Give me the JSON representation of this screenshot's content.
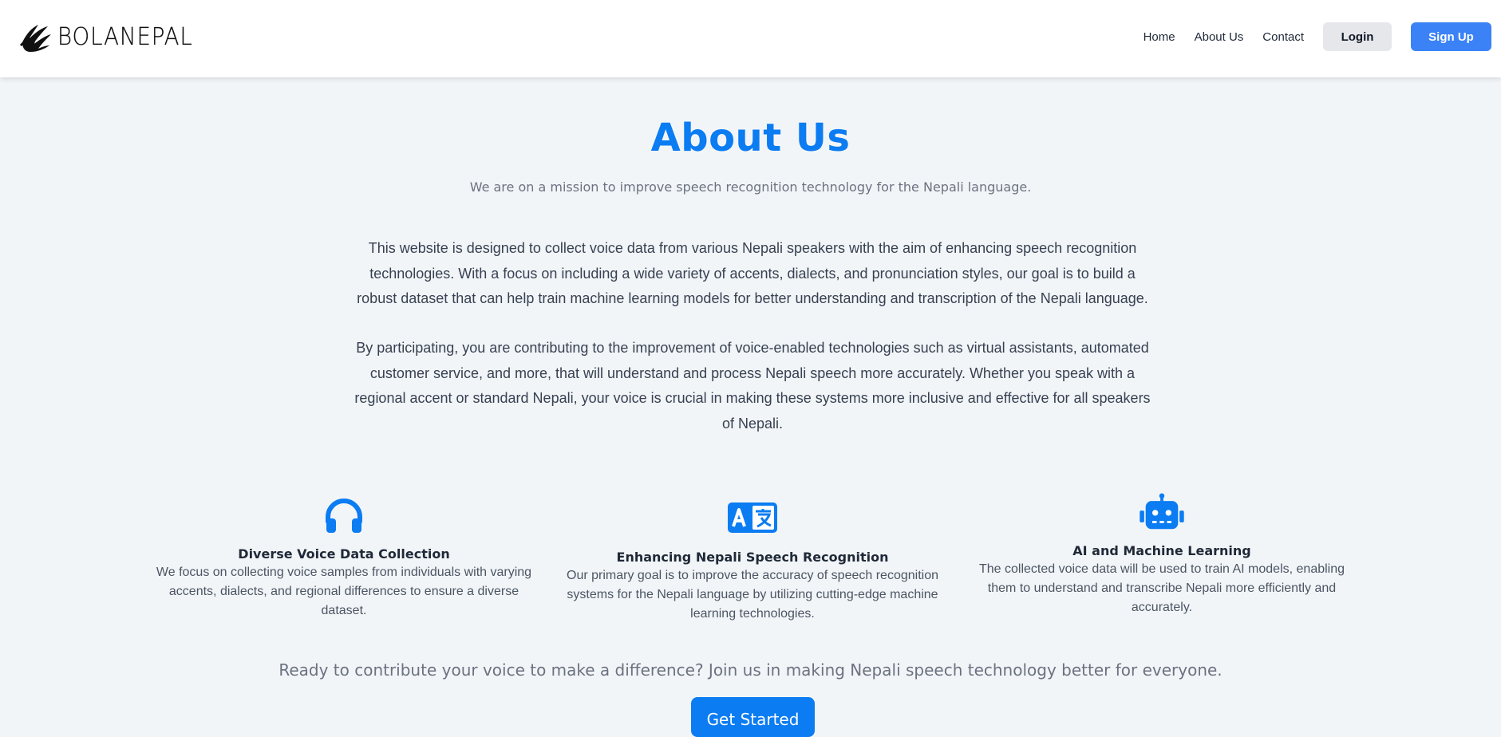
{
  "header": {
    "logo_text": "BOLANEPAL",
    "nav": {
      "home": "Home",
      "about": "About Us",
      "contact": "Contact",
      "login": "Login",
      "signup": "Sign Up"
    }
  },
  "colors": {
    "brand_blue": "#0b7cf2",
    "signup_blue": "#3b82f6",
    "login_bg": "#e5e7eb",
    "page_bg": "#f2f5f8"
  },
  "about": {
    "title": "About Us",
    "subtitle": "We are on a mission to improve speech recognition technology for the Nepali language.",
    "paragraph1": "This website is designed to collect voice data from various Nepali speakers with the aim of enhancing speech recognition technologies. With a focus on including a wide variety of accents, dialects, and pronunciation styles, our goal is to build a robust dataset that can help train machine learning models for better understanding and transcription of the Nepali language.",
    "paragraph2": "By participating, you are contributing to the improvement of voice-enabled technologies such as virtual assistants, automated customer service, and more, that will understand and process Nepali speech more accurately. Whether you speak with a regional accent or standard Nepali, your voice is crucial in making these systems more inclusive and effective for all speakers of Nepali."
  },
  "features": [
    {
      "icon": "headphones-icon",
      "title": "Diverse Voice Data Collection",
      "description": "We focus on collecting voice samples from individuals with varying accents, dialects, and regional differences to ensure a diverse dataset."
    },
    {
      "icon": "translate-icon",
      "title": "Enhancing Nepali Speech Recognition",
      "description": "Our primary goal is to improve the accuracy of speech recognition systems for the Nepali language by utilizing cutting-edge machine learning technologies."
    },
    {
      "icon": "robot-icon",
      "title": "AI and Machine Learning",
      "description": "The collected voice data will be used to train AI models, enabling them to understand and transcribe Nepali more efficiently and accurately."
    }
  ],
  "cta": {
    "text": "Ready to contribute your voice to make a difference? Join us in making Nepali speech technology better for everyone.",
    "button": "Get Started"
  }
}
